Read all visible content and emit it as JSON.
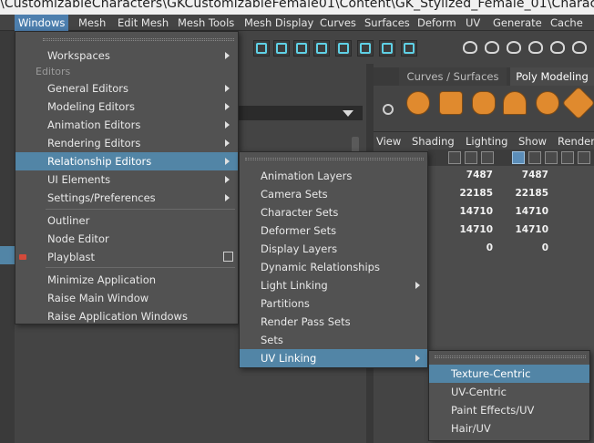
{
  "window": {
    "title": "\\CustomizableCharacters\\GKCustomizableFemale01\\Content\\GK_Stylized_Female_01\\Character\\M"
  },
  "menubar": {
    "items": [
      {
        "label": "Windows",
        "active": true
      },
      {
        "label": "Mesh"
      },
      {
        "label": "Edit Mesh"
      },
      {
        "label": "Mesh Tools"
      },
      {
        "label": "Mesh Display"
      },
      {
        "label": "Curves"
      },
      {
        "label": "Surfaces"
      },
      {
        "label": "Deform"
      },
      {
        "label": "UV"
      },
      {
        "label": "Generate"
      },
      {
        "label": "Cache"
      }
    ]
  },
  "shelf": {
    "tabs": [
      "Curves / Surfaces",
      "Poly Modeling"
    ],
    "active_tab": "Poly Modeling"
  },
  "viewport": {
    "menu": [
      "View",
      "Shading",
      "Lighting",
      "Show",
      "Renderer"
    ],
    "hud": [
      [
        "7487",
        "7487"
      ],
      [
        "22185",
        "22185"
      ],
      [
        "14710",
        "14710"
      ],
      [
        "14710",
        "14710"
      ],
      [
        "0",
        "0"
      ]
    ]
  },
  "windows_menu": {
    "section_label": "Editors",
    "items": [
      {
        "label": "Workspaces",
        "submenu": true
      },
      {
        "label": "General Editors",
        "submenu": true
      },
      {
        "label": "Modeling Editors",
        "submenu": true
      },
      {
        "label": "Animation Editors",
        "submenu": true
      },
      {
        "label": "Rendering Editors",
        "submenu": true
      },
      {
        "label": "Relationship Editors",
        "submenu": true,
        "highlighted": true
      },
      {
        "label": "UI Elements",
        "submenu": true
      },
      {
        "label": "Settings/Preferences",
        "submenu": true
      },
      {
        "label": "Outliner"
      },
      {
        "label": "Node Editor"
      },
      {
        "label": "Playblast",
        "option_box": true
      },
      {
        "label": "Minimize Application"
      },
      {
        "label": "Raise Main Window"
      },
      {
        "label": "Raise Application Windows"
      }
    ]
  },
  "relationship_menu": {
    "items": [
      {
        "label": "Animation Layers"
      },
      {
        "label": "Camera Sets"
      },
      {
        "label": "Character Sets"
      },
      {
        "label": "Deformer Sets"
      },
      {
        "label": "Display Layers"
      },
      {
        "label": "Dynamic Relationships"
      },
      {
        "label": "Light Linking",
        "submenu": true
      },
      {
        "label": "Partitions"
      },
      {
        "label": "Render Pass Sets"
      },
      {
        "label": "Sets"
      },
      {
        "label": "UV Linking",
        "submenu": true,
        "highlighted": true
      }
    ]
  },
  "uv_linking_menu": {
    "items": [
      {
        "label": "Texture-Centric",
        "highlighted": true
      },
      {
        "label": "UV-Centric"
      },
      {
        "label": "Paint Effects/UV"
      },
      {
        "label": "Hair/UV"
      }
    ]
  },
  "colors": {
    "highlight": "#5285a6",
    "menubar_active": "#4d7fae",
    "poly_icon": "#e08a2e",
    "tool_icon": "#5fd1e6"
  }
}
